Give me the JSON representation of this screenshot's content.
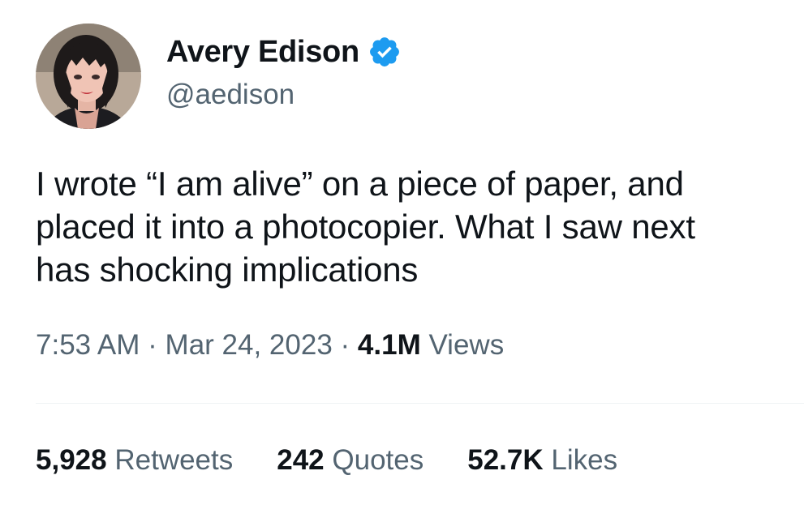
{
  "author": {
    "display_name": "Avery Edison",
    "handle": "@aedison",
    "verified": true,
    "avatar_icon": "profile-photo"
  },
  "tweet": {
    "text_lines": [
      "I wrote “I am alive” on a piece of paper, and",
      "placed it into a photocopier. What I saw next",
      "has shocking implications"
    ]
  },
  "meta": {
    "time": "7:53 AM",
    "sep1": "·",
    "date": "Mar 24, 2023",
    "sep2": "·",
    "views_count": "4.1M",
    "views_label": "Views"
  },
  "stats": {
    "retweets_count": "5,928",
    "retweets_label": "Retweets",
    "quotes_count": "242",
    "quotes_label": "Quotes",
    "likes_count": "52.7K",
    "likes_label": "Likes"
  },
  "colors": {
    "text_primary": "#0f1419",
    "text_secondary": "#536471",
    "verified_blue": "#1d9bf0",
    "divider": "#eff3f4"
  }
}
